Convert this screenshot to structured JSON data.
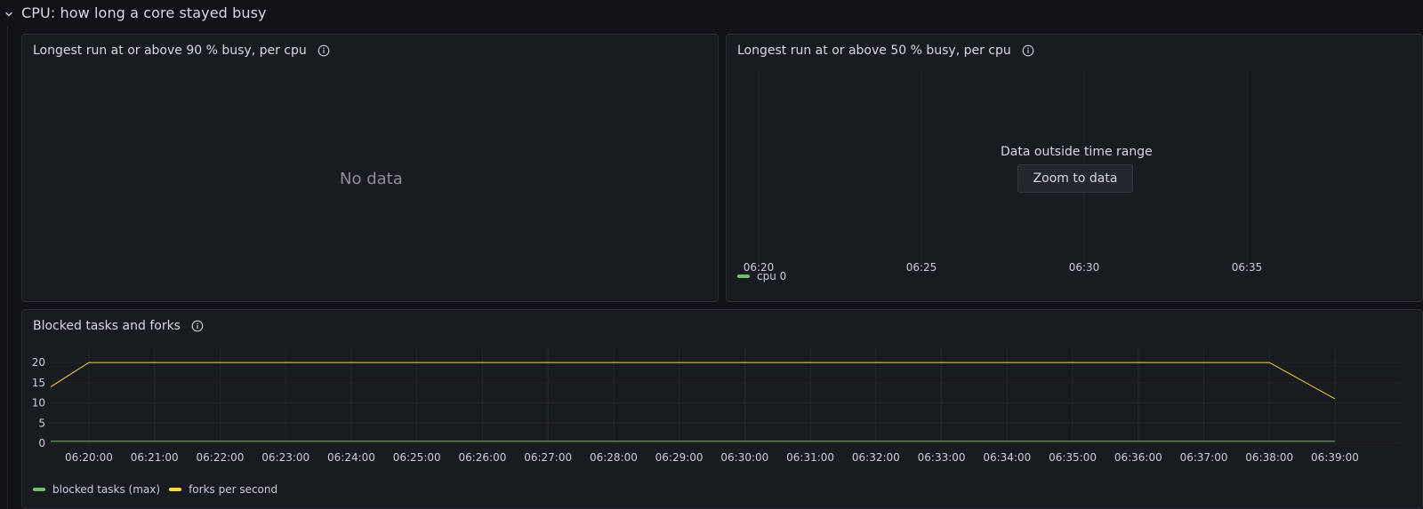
{
  "row": {
    "title": "CPU: how long a core stayed busy"
  },
  "panel_a": {
    "title": "Longest run at or above 90 % busy, per cpu",
    "no_data": "No data"
  },
  "panel_b": {
    "title": "Longest run at or above 50 % busy, per cpu",
    "message": "Data outside time range",
    "zoom_label": "Zoom to data",
    "x_ticks": [
      "06:20",
      "06:25",
      "06:30",
      "06:35"
    ],
    "legend": [
      {
        "name": "cpu 0",
        "color": "#73bf69"
      }
    ]
  },
  "panel_c": {
    "title": "Blocked tasks and forks",
    "legend": [
      {
        "name": "blocked tasks (max)",
        "color": "#73bf69"
      },
      {
        "name": "forks per second",
        "color": "#fade2a"
      }
    ]
  },
  "chart_data": {
    "type": "line",
    "title": "Blocked tasks and forks",
    "x_ticks": [
      "06:20:00",
      "06:21:00",
      "06:22:00",
      "06:23:00",
      "06:24:00",
      "06:25:00",
      "06:26:00",
      "06:27:00",
      "06:28:00",
      "06:29:00",
      "06:30:00",
      "06:31:00",
      "06:32:00",
      "06:33:00",
      "06:34:00",
      "06:35:00",
      "06:36:00",
      "06:37:00",
      "06:38:00",
      "06:39:00"
    ],
    "x_range": [
      "06:19:25",
      "06:39:00"
    ],
    "y_ticks": [
      0,
      5,
      10,
      15,
      20
    ],
    "ylim": [
      0,
      22
    ],
    "grid": true,
    "legend_position": "bottom-left",
    "series": [
      {
        "name": "blocked tasks (max)",
        "color": "#73bf69",
        "points": [
          [
            "06:19:25",
            0.5
          ],
          [
            "06:39:00",
            0.5
          ]
        ]
      },
      {
        "name": "forks per second",
        "color": "#fade2a",
        "points": [
          [
            "06:19:25",
            14
          ],
          [
            "06:20:00",
            20
          ],
          [
            "06:38:00",
            20
          ],
          [
            "06:39:00",
            11
          ]
        ]
      }
    ]
  }
}
